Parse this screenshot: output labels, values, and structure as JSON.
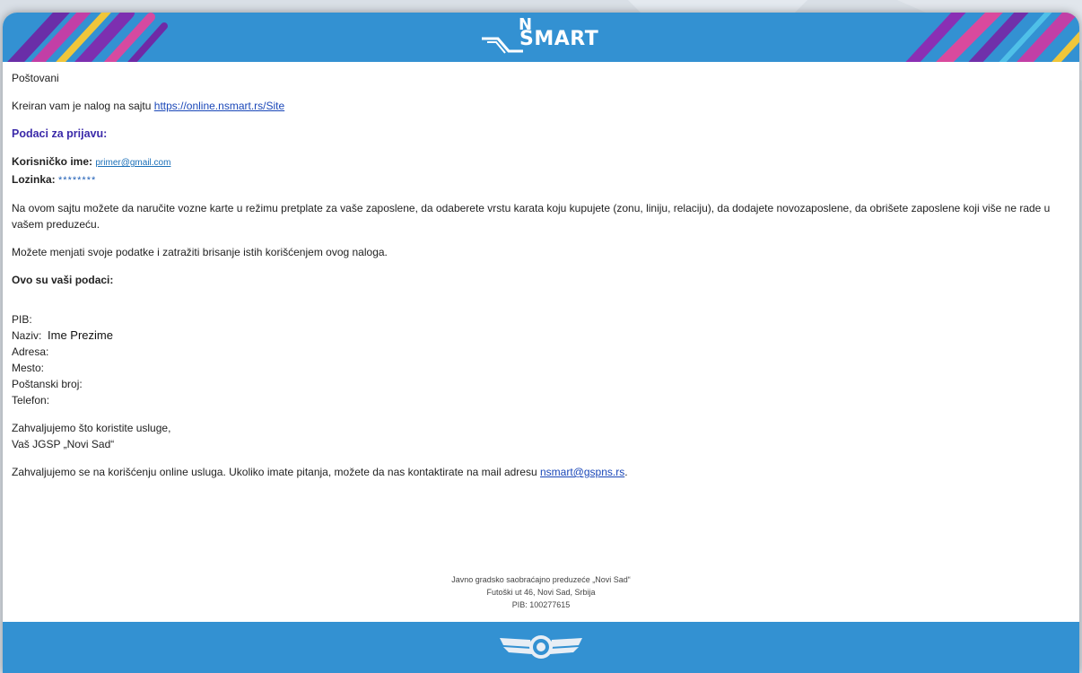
{
  "header": {
    "logo_text": "SMART",
    "logo_n": "N"
  },
  "email": {
    "greeting": "Poštovani",
    "account_created_prefix": "Kreiran vam je nalog na sajtu ",
    "site_link": "https://online.nsmart.rs/Site",
    "login_section_title": "Podaci za prijavu:",
    "username_label": "Korisničko ime:",
    "username_value": "primer@gmail.com",
    "password_label": "Lozinka:",
    "password_value": "********",
    "description": "Na ovom sajtu možete da naručite vozne karte u režimu pretplate za vaše zaposlene, da odaberete vrstu karata koju kupujete (zonu, liniju, relaciju), da dodajete novozaposlene, da obrišete zaposlene koji više ne rade u vašem preduzeću.",
    "manage_data_text": "Možete menjati svoje podatke i zatražiti brisanje istih korišćenjem ovog naloga.",
    "your_data_title": "Ovo su vaši podaci:",
    "fields": {
      "pib": "PIB:",
      "naziv": "Naziv:",
      "naziv_value": "Ime Prezime",
      "adresa": "Adresa:",
      "mesto": "Mesto:",
      "postanski": "Poštanski broj:",
      "telefon": "Telefon:"
    },
    "thanks_line1": "Zahvaljujemo što koristite usluge,",
    "thanks_line2": "Vaš JGSP „Novi Sad“",
    "contact_prefix": "Zahvaljujemo se na korišćenju online usluga. Ukoliko imate pitanja, možete da nas kontaktirate na mail adresu ",
    "contact_email": "nsmart@gspns.rs",
    "contact_suffix": "."
  },
  "footer": {
    "company": "Javno gradsko saobraćajno preduzeće „Novi Sad“",
    "address": "Futoški ut 46, Novi Sad, Srbija",
    "pib": "PIB: 100277615"
  },
  "colors": {
    "header_blue": "#3391d2",
    "link_blue": "#1a47b8",
    "section_purple": "#3b2aa9"
  }
}
